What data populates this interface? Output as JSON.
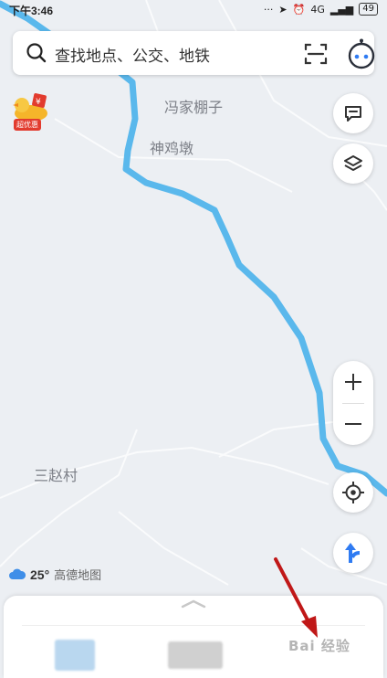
{
  "status": {
    "time": "下午3:46",
    "battery": "49",
    "network": "4G"
  },
  "search": {
    "placeholder": "查找地点、公交、地铁"
  },
  "promo": {
    "badge": "超优惠"
  },
  "map_labels": {
    "feng": "冯家棚子",
    "shen": "神鸡墩",
    "san": "三赵村"
  },
  "weather": {
    "temp": "25°",
    "brand": "高德地图"
  },
  "zoom": {
    "plus": "+",
    "minus": "−"
  },
  "watermark": "Bai 经验",
  "colors": {
    "river": "#5ab8ec",
    "accent": "#2f7bf2",
    "promo_red": "#e23b2e",
    "arrow": "#c01818"
  },
  "icons": [
    "search-icon",
    "scan-icon",
    "avatar-icon",
    "message-icon",
    "layers-icon",
    "locate-icon",
    "navigation-icon",
    "cloud-icon",
    "chevron-up-icon"
  ]
}
